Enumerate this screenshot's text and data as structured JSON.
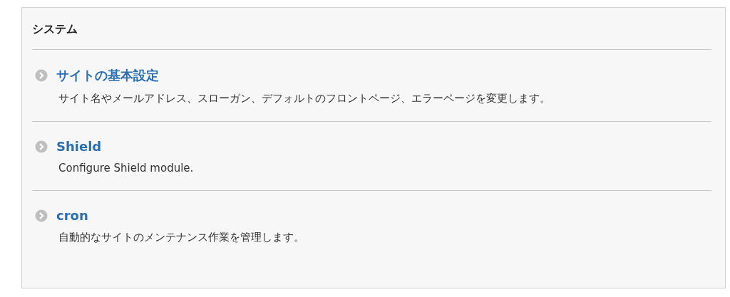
{
  "panel": {
    "title": "システム"
  },
  "items": [
    {
      "title": "サイトの基本設定",
      "description": "サイト名やメールアドレス、スローガン、デフォルトのフロントページ、エラーページを変更します。"
    },
    {
      "title": "Shield",
      "description": "Configure Shield module."
    },
    {
      "title": "cron",
      "description": "自動的なサイトのメンテナンス作業を管理します。"
    }
  ]
}
